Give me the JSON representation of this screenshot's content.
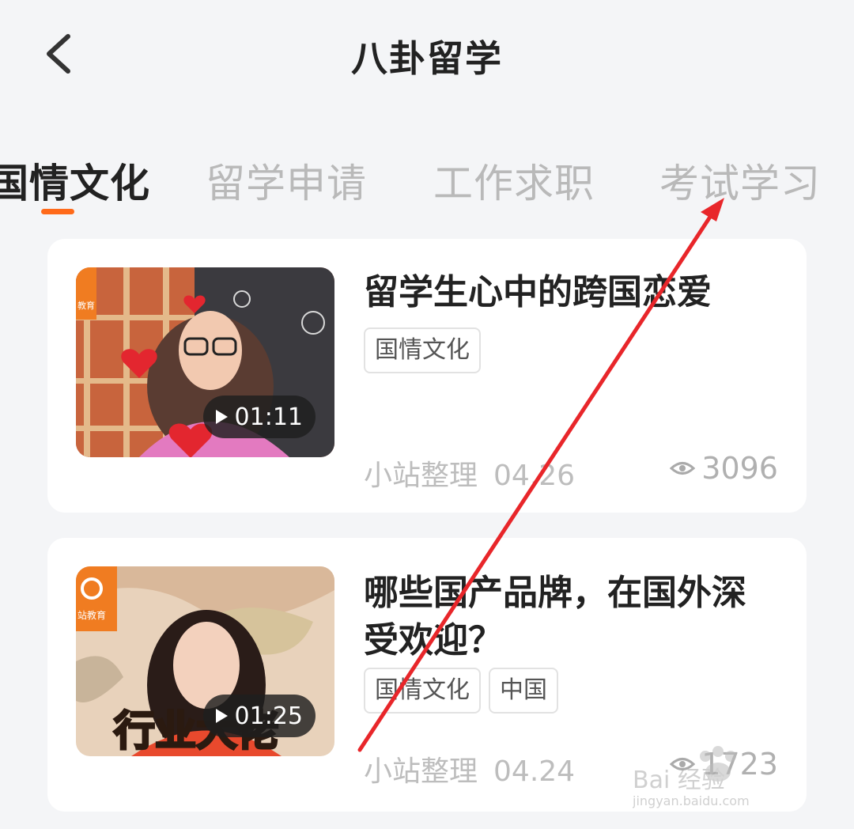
{
  "header": {
    "title": "八卦留学",
    "back_icon": "chevron-left-icon"
  },
  "tabs": [
    {
      "label": "国情文化",
      "active": true
    },
    {
      "label": "留学申请",
      "active": false
    },
    {
      "label": "工作求职",
      "active": false
    },
    {
      "label": "考试学习",
      "active": false
    }
  ],
  "articles": [
    {
      "title": "留学生心中的跨国恋爱",
      "tags": [
        "国情文化"
      ],
      "duration": "01:11",
      "author": "小站整理",
      "date": "04.26",
      "views": "3096",
      "thumb_badge": "教育"
    },
    {
      "title": "哪些国产品牌，在国外深受欢迎？",
      "tags": [
        "国情文化",
        "中国"
      ],
      "duration": "01:25",
      "author": "小站整理",
      "date": "04.24",
      "views": "1723",
      "thumb_badge": "站教育",
      "thumb_caption": "行业大佬"
    }
  ],
  "colors": {
    "accent": "#ff6a1a",
    "annotation_arrow": "#e8262a"
  },
  "watermark": {
    "text": "Bai 经验",
    "subtext": "jingyan.baidu.com"
  }
}
